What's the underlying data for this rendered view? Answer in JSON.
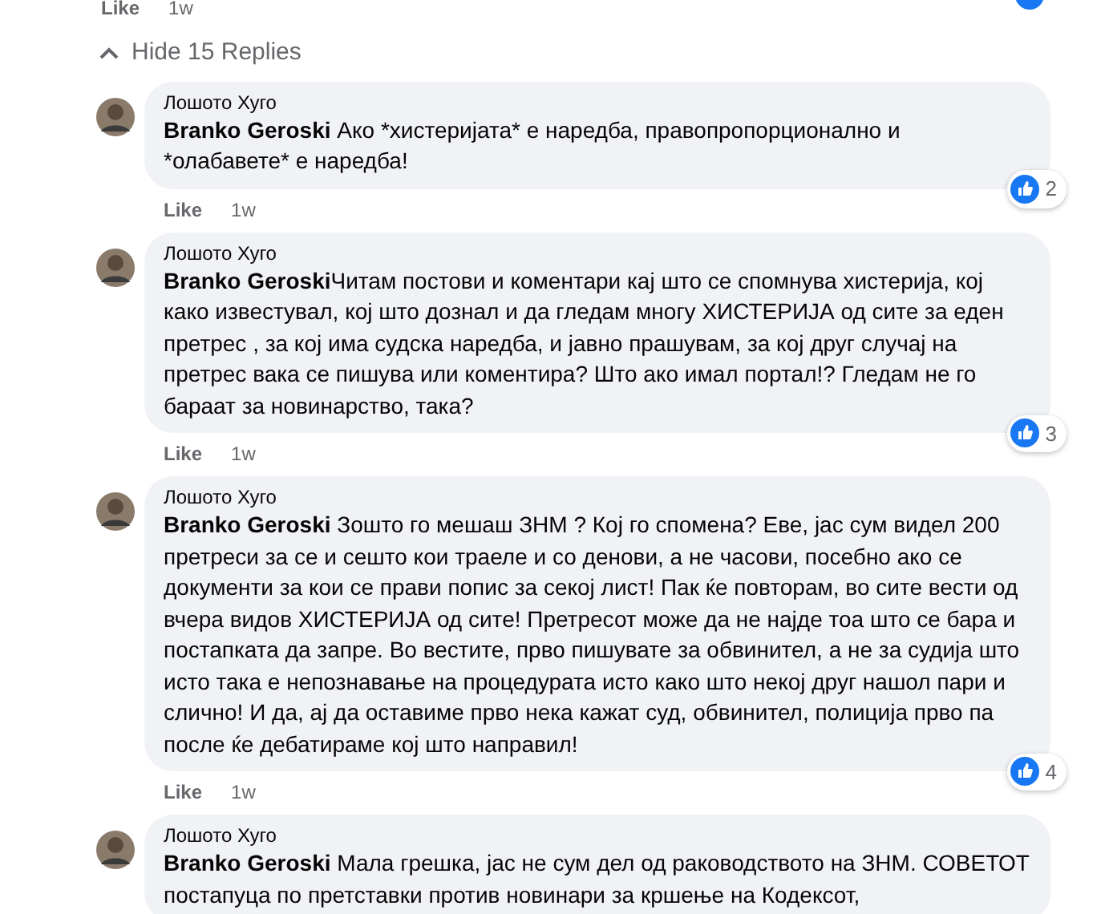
{
  "top_actions": {
    "like": "Like",
    "time": "1w"
  },
  "hide_replies": "Hide 15 Replies",
  "replies": [
    {
      "author": "Лошото Хуго",
      "mention": "Branko Geroski",
      "text": " Ако *хистеријата* е наредба, правопропорционално и *олабавете* е наредба!",
      "like": "Like",
      "time": "1w",
      "reactions": "2"
    },
    {
      "author": "Лошото Хуго",
      "mention": "Branko Geroski",
      "text": "Читам постови и коментари кај што се спомнува хистерија, кој како известувал, кој што дознал и да гледам многу ХИСТЕРИЈА од сите за еден претрес , за кој има судска наредба, и јавно прашувам, за кој друг случај на претрес вака се пишува или коментира? Што ако имал портал!? Гледам не го бараат за новинарство, така?",
      "like": "Like",
      "time": "1w",
      "reactions": "3"
    },
    {
      "author": "Лошото Хуго",
      "mention": "Branko Geroski",
      "text": " Зошто го мешаш ЗНМ ? Кој го спомена? Еве, јас сум видел 200 претреси за се и сешто кои траеле и со денови, а не часови, посебно ако се документи за кои се прави попис за секој лист! Пак ќе повторам, во сите вести од вчера видов ХИСТЕРИЈА од сите! Претресот може да не најде тоа што се бара и постапката да запре. Во вестите, прво пишувате за обвинител, а не за судија што исто така е непознавање на процедурата исто како што некој друг нашол пари и слично! И да, ај да оставиме прво нека кажат суд, обвинител, полиција прво па после ќе дебатираме кој што направил!",
      "like": "Like",
      "time": "1w",
      "reactions": "4"
    },
    {
      "author": "Лошото Хуго",
      "mention": "Branko Geroski",
      "text": " Мала грешка, јас не сум дел од раководството на ЗНМ. СОВЕТОТ постапуца по претставки против новинари за кршење на Кодексот,"
    }
  ]
}
